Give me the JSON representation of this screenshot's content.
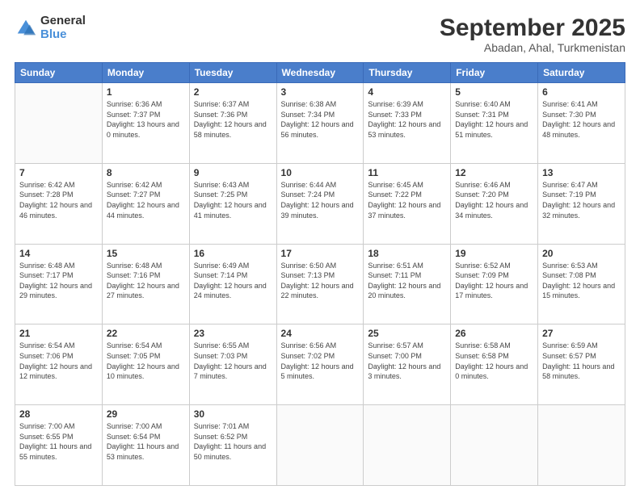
{
  "logo": {
    "general": "General",
    "blue": "Blue"
  },
  "title": "September 2025",
  "subtitle": "Abadan, Ahal, Turkmenistan",
  "days_of_week": [
    "Sunday",
    "Monday",
    "Tuesday",
    "Wednesday",
    "Thursday",
    "Friday",
    "Saturday"
  ],
  "weeks": [
    [
      {
        "day": "",
        "sunrise": "",
        "sunset": "",
        "daylight": ""
      },
      {
        "day": "1",
        "sunrise": "Sunrise: 6:36 AM",
        "sunset": "Sunset: 7:37 PM",
        "daylight": "Daylight: 13 hours and 0 minutes."
      },
      {
        "day": "2",
        "sunrise": "Sunrise: 6:37 AM",
        "sunset": "Sunset: 7:36 PM",
        "daylight": "Daylight: 12 hours and 58 minutes."
      },
      {
        "day": "3",
        "sunrise": "Sunrise: 6:38 AM",
        "sunset": "Sunset: 7:34 PM",
        "daylight": "Daylight: 12 hours and 56 minutes."
      },
      {
        "day": "4",
        "sunrise": "Sunrise: 6:39 AM",
        "sunset": "Sunset: 7:33 PM",
        "daylight": "Daylight: 12 hours and 53 minutes."
      },
      {
        "day": "5",
        "sunrise": "Sunrise: 6:40 AM",
        "sunset": "Sunset: 7:31 PM",
        "daylight": "Daylight: 12 hours and 51 minutes."
      },
      {
        "day": "6",
        "sunrise": "Sunrise: 6:41 AM",
        "sunset": "Sunset: 7:30 PM",
        "daylight": "Daylight: 12 hours and 48 minutes."
      }
    ],
    [
      {
        "day": "7",
        "sunrise": "Sunrise: 6:42 AM",
        "sunset": "Sunset: 7:28 PM",
        "daylight": "Daylight: 12 hours and 46 minutes."
      },
      {
        "day": "8",
        "sunrise": "Sunrise: 6:42 AM",
        "sunset": "Sunset: 7:27 PM",
        "daylight": "Daylight: 12 hours and 44 minutes."
      },
      {
        "day": "9",
        "sunrise": "Sunrise: 6:43 AM",
        "sunset": "Sunset: 7:25 PM",
        "daylight": "Daylight: 12 hours and 41 minutes."
      },
      {
        "day": "10",
        "sunrise": "Sunrise: 6:44 AM",
        "sunset": "Sunset: 7:24 PM",
        "daylight": "Daylight: 12 hours and 39 minutes."
      },
      {
        "day": "11",
        "sunrise": "Sunrise: 6:45 AM",
        "sunset": "Sunset: 7:22 PM",
        "daylight": "Daylight: 12 hours and 37 minutes."
      },
      {
        "day": "12",
        "sunrise": "Sunrise: 6:46 AM",
        "sunset": "Sunset: 7:20 PM",
        "daylight": "Daylight: 12 hours and 34 minutes."
      },
      {
        "day": "13",
        "sunrise": "Sunrise: 6:47 AM",
        "sunset": "Sunset: 7:19 PM",
        "daylight": "Daylight: 12 hours and 32 minutes."
      }
    ],
    [
      {
        "day": "14",
        "sunrise": "Sunrise: 6:48 AM",
        "sunset": "Sunset: 7:17 PM",
        "daylight": "Daylight: 12 hours and 29 minutes."
      },
      {
        "day": "15",
        "sunrise": "Sunrise: 6:48 AM",
        "sunset": "Sunset: 7:16 PM",
        "daylight": "Daylight: 12 hours and 27 minutes."
      },
      {
        "day": "16",
        "sunrise": "Sunrise: 6:49 AM",
        "sunset": "Sunset: 7:14 PM",
        "daylight": "Daylight: 12 hours and 24 minutes."
      },
      {
        "day": "17",
        "sunrise": "Sunrise: 6:50 AM",
        "sunset": "Sunset: 7:13 PM",
        "daylight": "Daylight: 12 hours and 22 minutes."
      },
      {
        "day": "18",
        "sunrise": "Sunrise: 6:51 AM",
        "sunset": "Sunset: 7:11 PM",
        "daylight": "Daylight: 12 hours and 20 minutes."
      },
      {
        "day": "19",
        "sunrise": "Sunrise: 6:52 AM",
        "sunset": "Sunset: 7:09 PM",
        "daylight": "Daylight: 12 hours and 17 minutes."
      },
      {
        "day": "20",
        "sunrise": "Sunrise: 6:53 AM",
        "sunset": "Sunset: 7:08 PM",
        "daylight": "Daylight: 12 hours and 15 minutes."
      }
    ],
    [
      {
        "day": "21",
        "sunrise": "Sunrise: 6:54 AM",
        "sunset": "Sunset: 7:06 PM",
        "daylight": "Daylight: 12 hours and 12 minutes."
      },
      {
        "day": "22",
        "sunrise": "Sunrise: 6:54 AM",
        "sunset": "Sunset: 7:05 PM",
        "daylight": "Daylight: 12 hours and 10 minutes."
      },
      {
        "day": "23",
        "sunrise": "Sunrise: 6:55 AM",
        "sunset": "Sunset: 7:03 PM",
        "daylight": "Daylight: 12 hours and 7 minutes."
      },
      {
        "day": "24",
        "sunrise": "Sunrise: 6:56 AM",
        "sunset": "Sunset: 7:02 PM",
        "daylight": "Daylight: 12 hours and 5 minutes."
      },
      {
        "day": "25",
        "sunrise": "Sunrise: 6:57 AM",
        "sunset": "Sunset: 7:00 PM",
        "daylight": "Daylight: 12 hours and 3 minutes."
      },
      {
        "day": "26",
        "sunrise": "Sunrise: 6:58 AM",
        "sunset": "Sunset: 6:58 PM",
        "daylight": "Daylight: 12 hours and 0 minutes."
      },
      {
        "day": "27",
        "sunrise": "Sunrise: 6:59 AM",
        "sunset": "Sunset: 6:57 PM",
        "daylight": "Daylight: 11 hours and 58 minutes."
      }
    ],
    [
      {
        "day": "28",
        "sunrise": "Sunrise: 7:00 AM",
        "sunset": "Sunset: 6:55 PM",
        "daylight": "Daylight: 11 hours and 55 minutes."
      },
      {
        "day": "29",
        "sunrise": "Sunrise: 7:00 AM",
        "sunset": "Sunset: 6:54 PM",
        "daylight": "Daylight: 11 hours and 53 minutes."
      },
      {
        "day": "30",
        "sunrise": "Sunrise: 7:01 AM",
        "sunset": "Sunset: 6:52 PM",
        "daylight": "Daylight: 11 hours and 50 minutes."
      },
      {
        "day": "",
        "sunrise": "",
        "sunset": "",
        "daylight": ""
      },
      {
        "day": "",
        "sunrise": "",
        "sunset": "",
        "daylight": ""
      },
      {
        "day": "",
        "sunrise": "",
        "sunset": "",
        "daylight": ""
      },
      {
        "day": "",
        "sunrise": "",
        "sunset": "",
        "daylight": ""
      }
    ]
  ]
}
